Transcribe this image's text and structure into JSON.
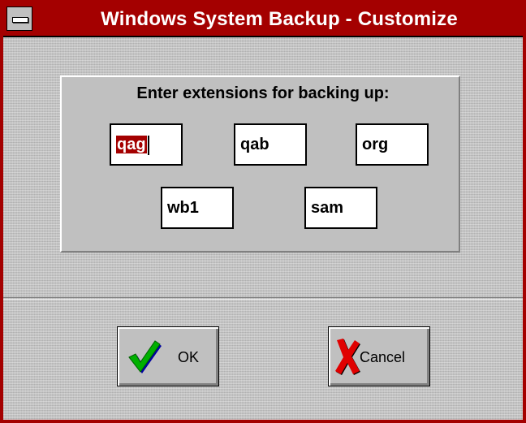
{
  "window": {
    "title": "Windows System Backup - Customize"
  },
  "dialog": {
    "prompt": "Enter extensions for backing up:",
    "extensions": [
      "qag",
      "qab",
      "org",
      "wb1",
      "sam"
    ]
  },
  "buttons": {
    "ok": {
      "label": "OK",
      "icon": "checkmark-icon"
    },
    "cancel": {
      "label": "Cancel",
      "icon": "red-x-icon"
    }
  },
  "colors": {
    "title_bar": "#a40000",
    "border": "#a40000",
    "selection": "#a40000",
    "face": "#c0c0c0"
  }
}
